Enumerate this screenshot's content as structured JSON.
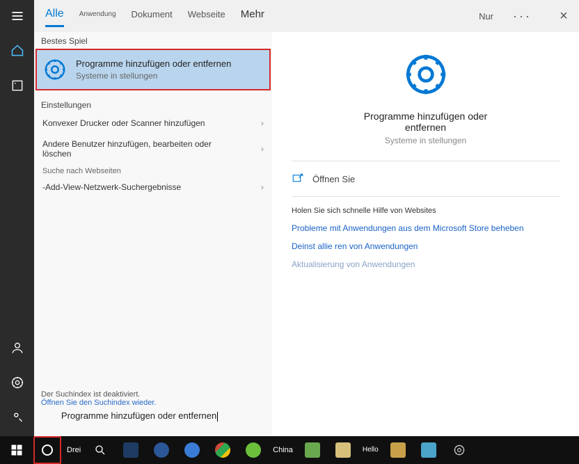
{
  "rail": {
    "items": [
      "menu",
      "home",
      "recent",
      "person",
      "settings",
      "feedback"
    ]
  },
  "tabs": {
    "active": "Alle",
    "items": [
      "Alle",
      "Anwendung",
      "Dokument",
      "Webseite",
      "Mehr"
    ],
    "right_label": "Nur",
    "dots": "···",
    "close": "×"
  },
  "left": {
    "best_label": "Bestes Spiel",
    "best_title": "Programme hinzufügen oder entfernen",
    "best_sub": "Systeme in stellungen",
    "settings_label": "Einstellungen",
    "items": [
      "Konvexer Drucker oder Scanner hinzufügen",
      "Andere Benutzer hinzufügen, bearbeiten oder löschen"
    ],
    "web_label": "Suche nach Webseiten",
    "web_item": "-Add-View-Netzwerk-Suchergebnisse",
    "status1": "Der Suchindex ist deaktiviert.",
    "status2": "Öffnen Sie den Suchindex wieder.",
    "search_value": "Programme hinzufügen oder entfernen"
  },
  "right": {
    "title": "Programme hinzufügen oder entfernen",
    "sub": "Systeme in stellungen",
    "open": "Öffnen Sie",
    "help_header": "Holen Sie sich schnelle Hilfe von Websites",
    "links": [
      "Probleme mit Anwendungen aus dem Microsoft Store beheben",
      "Deinst allie ren von Anwendungen",
      "Aktualisierung von Anwendungen"
    ]
  },
  "taskbar": {
    "labels": [
      "Drei",
      "China",
      "Hello"
    ],
    "icons": [
      {
        "name": "start",
        "color": "#fff"
      },
      {
        "name": "cortana",
        "color": "#fff"
      },
      {
        "name": "magnifier",
        "color": "#fff"
      },
      {
        "name": "ps",
        "color": "#1d3b63"
      },
      {
        "name": "edge1",
        "color": "#2b5797"
      },
      {
        "name": "edge2",
        "color": "#3a7bd5"
      },
      {
        "name": "chrome",
        "color": "#cc4b3a"
      },
      {
        "name": "green",
        "color": "#6cbf3b"
      },
      {
        "name": "excel",
        "color": "#6aa84f"
      },
      {
        "name": "note",
        "color": "#d6c07b"
      },
      {
        "name": "weather",
        "color": "#c8a04a"
      },
      {
        "name": "people",
        "color": "#4aa3c8"
      },
      {
        "name": "gear",
        "color": "#aaa"
      }
    ]
  },
  "colors": {
    "accent": "#0078d4",
    "highlight_bg": "#b9d5ee",
    "red_frame": "#d62828"
  }
}
